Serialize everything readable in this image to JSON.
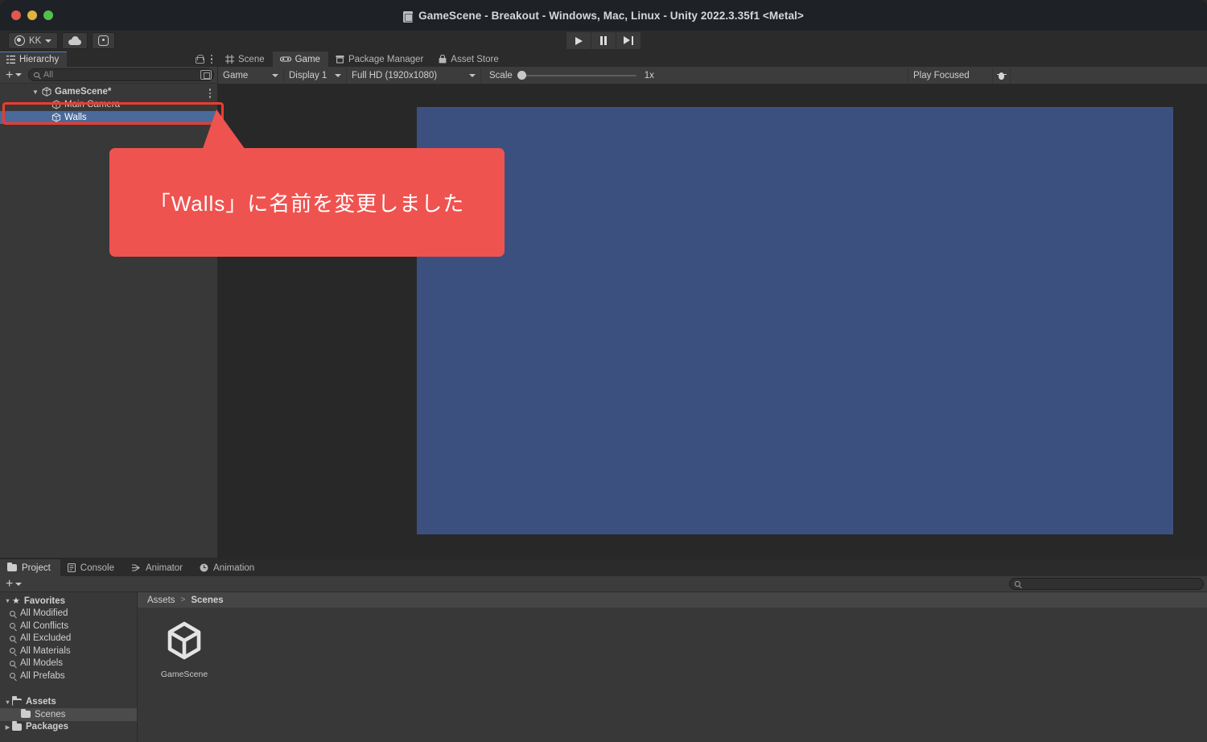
{
  "window": {
    "title": "GameScene - Breakout - Windows, Mac, Linux - Unity 2022.3.35f1 <Metal>",
    "title_icon": "unity-scene-file-icon",
    "traffic_lights": [
      "close-red",
      "minimize-yellow",
      "maximize-green"
    ]
  },
  "main_toolbar": {
    "account_label": "KK",
    "account_icon": "account-avatar-icon",
    "cloud_icon": "cloud-icon",
    "settings_icon": "gear-icon",
    "transport": [
      {
        "name": "play-button",
        "icon": "play-icon"
      },
      {
        "name": "pause-button",
        "icon": "pause-icon"
      },
      {
        "name": "step-button",
        "icon": "step-forward-icon"
      }
    ]
  },
  "hierarchy": {
    "tab_label": "Hierarchy",
    "tab_icon": "hierarchy-icon",
    "lock_icon": "lock-open-icon",
    "menu_icon": "kebab-menu-icon",
    "add_label": "+",
    "search_placeholder": "All",
    "search_icon": "search-icon",
    "rows": [
      {
        "label": "GameScene*",
        "icon": "unity-scene-icon",
        "depth": 0,
        "expanded": true,
        "selected": false,
        "has_menu": true
      },
      {
        "label": "Main Camera",
        "icon": "gameobject-cube-icon",
        "depth": 1,
        "expanded": false,
        "selected": false,
        "has_menu": false
      },
      {
        "label": "Walls",
        "icon": "gameobject-cube-icon",
        "depth": 1,
        "expanded": false,
        "selected": true,
        "has_menu": false
      }
    ]
  },
  "center": {
    "tabs": [
      {
        "label": "Scene",
        "icon": "scene-grid-icon",
        "active": false
      },
      {
        "label": "Game",
        "icon": "game-controller-icon",
        "active": true
      },
      {
        "label": "Package Manager",
        "icon": "package-icon",
        "active": false
      },
      {
        "label": "Asset Store",
        "icon": "shopping-bag-icon",
        "active": false
      }
    ],
    "game_toolbar": {
      "view_mode": "Game",
      "display": "Display 1",
      "resolution": "Full HD (1920x1080)",
      "scale_label": "Scale",
      "scale_value": "1x",
      "play_mode": "Play Focused",
      "stats_icon": "bug-icon"
    },
    "game_view_color": "#3c5080"
  },
  "bottom": {
    "tabs": [
      {
        "label": "Project",
        "icon": "folder-icon",
        "active": true
      },
      {
        "label": "Console",
        "icon": "console-icon",
        "active": false
      },
      {
        "label": "Animator",
        "icon": "animator-icon",
        "active": false
      },
      {
        "label": "Animation",
        "icon": "animation-clock-icon",
        "active": false
      }
    ],
    "add_label": "+",
    "search_placeholder": "",
    "search_icon": "search-icon",
    "tree": [
      {
        "label": "Favorites",
        "kind": "favorites",
        "depth": 0,
        "expanded": true,
        "selected": false,
        "bold": true
      },
      {
        "label": "All Modified",
        "kind": "saved-search",
        "depth": 1,
        "expanded": false,
        "selected": false,
        "bold": false
      },
      {
        "label": "All Conflicts",
        "kind": "saved-search",
        "depth": 1,
        "expanded": false,
        "selected": false,
        "bold": false
      },
      {
        "label": "All Excluded",
        "kind": "saved-search",
        "depth": 1,
        "expanded": false,
        "selected": false,
        "bold": false
      },
      {
        "label": "All Materials",
        "kind": "saved-search",
        "depth": 1,
        "expanded": false,
        "selected": false,
        "bold": false
      },
      {
        "label": "All Models",
        "kind": "saved-search",
        "depth": 1,
        "expanded": false,
        "selected": false,
        "bold": false
      },
      {
        "label": "All Prefabs",
        "kind": "saved-search",
        "depth": 1,
        "expanded": false,
        "selected": false,
        "bold": false
      },
      {
        "label": "",
        "kind": "spacer",
        "depth": 0,
        "expanded": false,
        "selected": false,
        "bold": false
      },
      {
        "label": "Assets",
        "kind": "folder-open",
        "depth": 0,
        "expanded": true,
        "selected": false,
        "bold": true
      },
      {
        "label": "Scenes",
        "kind": "folder",
        "depth": 1,
        "expanded": false,
        "selected": true,
        "bold": false
      },
      {
        "label": "Packages",
        "kind": "folder",
        "depth": 0,
        "expanded": false,
        "selected": false,
        "bold": true
      }
    ],
    "breadcrumb": [
      "Assets",
      "Scenes"
    ],
    "breadcrumb_sep": ">",
    "assets": [
      {
        "label": "GameScene",
        "icon": "unity-scene-asset-icon"
      }
    ]
  },
  "annotations": {
    "highlight_target": "Walls",
    "highlight_color": "#ee3b2f",
    "callout_color": "#ef5350",
    "callout_text": "「Walls」に名前を変更しました"
  }
}
